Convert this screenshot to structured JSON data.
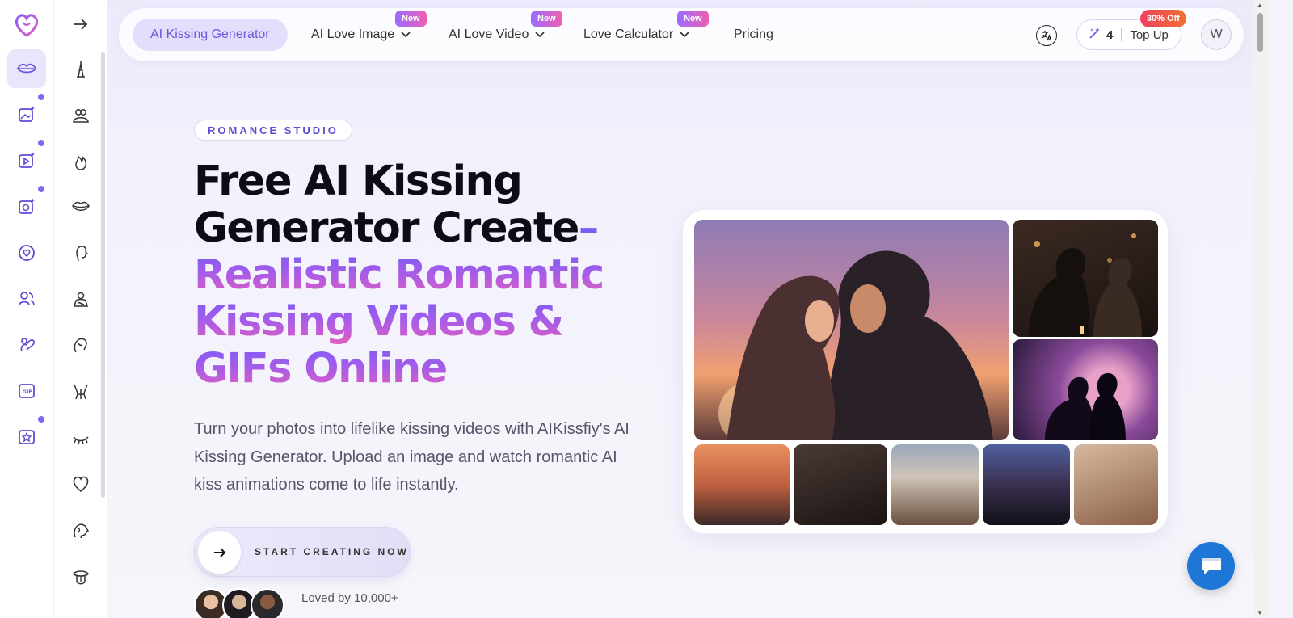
{
  "nav": {
    "items": [
      {
        "label": "AI Kissing Generator",
        "active": true,
        "dropdown": false,
        "badge": ""
      },
      {
        "label": "AI Love Image",
        "active": false,
        "dropdown": true,
        "badge": "New"
      },
      {
        "label": "AI Love Video",
        "active": false,
        "dropdown": true,
        "badge": "New"
      },
      {
        "label": "Love Calculator",
        "active": false,
        "dropdown": true,
        "badge": "New"
      },
      {
        "label": "Pricing",
        "active": false,
        "dropdown": false,
        "badge": ""
      }
    ],
    "credits": "4",
    "topup_label": "Top Up",
    "discount_badge": "30% Off",
    "avatar_initial": "W"
  },
  "hero": {
    "eyebrow": "ROMANCE STUDIO",
    "headline_line1": "Free AI Kissing",
    "headline_line2": "Generator Create",
    "headline_dash": "–",
    "headline_line3": "Realistic Romantic",
    "headline_line4": "Kissing Videos &",
    "headline_line5": "GIFs Online",
    "subtitle": "Turn your photos into lifelike kissing videos with AIKissfiy's AI Kissing Generator. Upload an image and watch romantic AI kiss animations come to life instantly.",
    "cta_label": "START CREATING NOW",
    "social_proof": "Loved by 10,000+"
  },
  "rail_icons": [
    "lips-icon",
    "image-sparkle-icon",
    "video-sparkle-icon",
    "photo-sparkle-icon",
    "heart-circle-icon",
    "couple-icon",
    "kiss-pose-icon",
    "gif-icon",
    "star-box-icon"
  ],
  "rail2_icons": [
    "arrow-right-icon",
    "eiffel-tower-icon",
    "hug-icon",
    "flame-icon",
    "lips-outline-icon",
    "face-profile-icon",
    "embrace-icon",
    "hair-couple-icon",
    "corset-icon",
    "eyelash-icon",
    "heart-outline-icon",
    "faces-icon",
    "tongue-icon"
  ],
  "colors": {
    "accent": "#6b57e0",
    "gradient_start": "#7a5cf7",
    "gradient_end": "#e45ec0",
    "chat_button": "#1e77d6"
  }
}
